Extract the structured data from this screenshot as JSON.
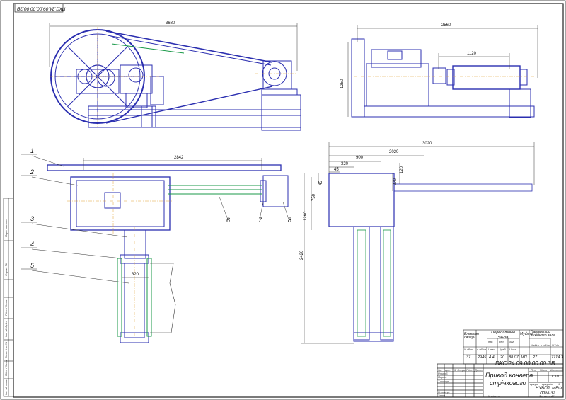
{
  "drawing": {
    "code_stamp": "ПКС.24.09.00.00.00.ЗВ",
    "dimensions": {
      "top_length": "3680",
      "side_width": "2560",
      "drum_length": "1120",
      "side_height": "1250",
      "plan_length": "2842",
      "drum_width": "320",
      "right_total": "3020",
      "right_d1": "2020",
      "right_d2": "900",
      "right_d3": "320",
      "right_d4": "45",
      "right_d5": "120",
      "right_v1": "45",
      "right_v2": "750",
      "right_v3": "270",
      "right_v4": "1260",
      "right_v5": "2420"
    },
    "callouts": [
      "1",
      "2",
      "3",
      "4",
      "5",
      "6",
      "7",
      "8"
    ]
  },
  "title_block": {
    "designation": "ПКС.24.09.00.00.00.ЗВ",
    "name_line1": "Привод конвера",
    "name_line2": "стрічкового",
    "scale_label": "Масштаб",
    "scale": "1:10",
    "sheet_label": "Аркуш",
    "sheets_label": "Аркушів",
    "sheets_count": "1",
    "org_line1": "НУВГП, МЕФ,",
    "org_line2": "ПТМ-32",
    "copied": "Копіював",
    "format": "Формат А1",
    "rows": [
      "Розроб.",
      "Перев.",
      "Т.контр.",
      "",
      "Н.контр.",
      "Затв."
    ],
    "cols": [
      "Зм.",
      "Арк.",
      "№ докум.",
      "Підп.",
      "Дата"
    ],
    "lit": "Літ.",
    "mass": "Маса"
  },
  "spec_table": {
    "h_motor": "Електро двигун",
    "h_ratio": "Передаточні числа",
    "h_coupling": "Муфта",
    "h_shaft": "Параметри вихідного вала",
    "sub_n": "N кВт",
    "sub_n_unit": "n об/хв",
    "sub_pas": "пас.",
    "sub_red": "ред.",
    "sub_zag": "заг.",
    "sub_u1": "Uпас",
    "sub_u2": "Uред",
    "sub_u3": "Uзаг",
    "sub_nvy": "N кВт",
    "sub_nvy_unit": "n об/хв",
    "sub_m": "М Нм",
    "v_n": "37",
    "v_rpm": "2945",
    "v_u1": "4.4",
    "v_u2": "20",
    "v_u3": "88.07",
    "v_coupling": "МП",
    "v_n_out": "27",
    "v_rpm_out": "",
    "v_m": "7714.3"
  },
  "side_stamps": [
    "Перв. застос.",
    "Справ. №",
    "Підп. і дата",
    "Інв. № дубл.",
    "Взам. інв. №",
    "Підп. і дата",
    "Інв. № ориг."
  ]
}
